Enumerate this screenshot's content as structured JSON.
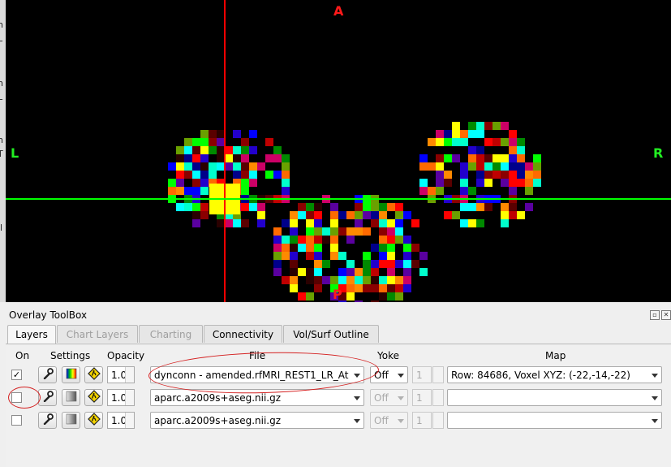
{
  "left_strip_fragments": [
    "n",
    "L",
    "n",
    "L",
    "n",
    "T",
    "il"
  ],
  "viewer": {
    "orientation_labels": {
      "top": "A",
      "left": "L",
      "right": "R",
      "bottom": "P"
    },
    "colors": {
      "crosshair_vertical": "#ff0000",
      "crosshair_horizontal": "#00ff00",
      "label_top_bottom": "#ff1a1a",
      "label_left_right": "#22ee22"
    }
  },
  "toolbox": {
    "title": "Overlay ToolBox",
    "window_buttons": [
      "restore-icon",
      "close-icon"
    ],
    "tabs": [
      {
        "label": "Layers",
        "state": "active"
      },
      {
        "label": "Chart Layers",
        "state": "disabled"
      },
      {
        "label": "Charting",
        "state": "disabled"
      },
      {
        "label": "Connectivity",
        "state": "normal"
      },
      {
        "label": "Vol/Surf Outline",
        "state": "normal"
      }
    ],
    "headers": {
      "on": "On",
      "settings": "Settings",
      "opacity": "Opacity",
      "file": "File",
      "yoke": "Yoke",
      "map": "Map"
    },
    "rows": [
      {
        "on": true,
        "on_mark": "✓",
        "colormap": "color",
        "opacity": "1.0",
        "file": "dynconn - amended.rfMRI_REST1_LR_At",
        "yoke": "Off",
        "yoke_enabled": true,
        "map_index": "1",
        "map": "Row: 84686, Voxel XYZ: (-22,-14,-22)",
        "map_enabled": true
      },
      {
        "on": false,
        "on_mark": "",
        "colormap": "gray",
        "opacity": "1.0",
        "file": "aparc.a2009s+aseg.nii.gz",
        "yoke": "Off",
        "yoke_enabled": false,
        "map_index": "1",
        "map": "",
        "map_enabled": false
      },
      {
        "on": false,
        "on_mark": "",
        "colormap": "gray",
        "opacity": "1.0",
        "file": "aparc.a2009s+aseg.nii.gz",
        "yoke": "Off",
        "yoke_enabled": false,
        "map_index": "1",
        "map": "",
        "map_enabled": false
      }
    ],
    "annotation_color": "#d42020"
  }
}
